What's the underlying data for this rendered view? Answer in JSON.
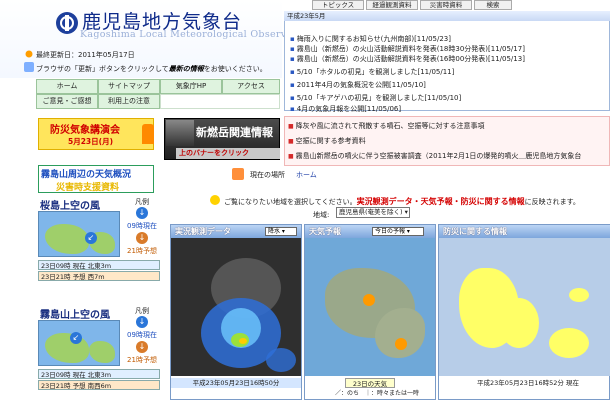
{
  "header": {
    "title": "鹿児島地方気象台",
    "title_en": "Kagoshima Local Meteorological Observatory",
    "updated": "最終更新日：2011年05月17日",
    "browser_note_pre": "ブラウザの「更新」ボタンをクリックして",
    "browser_note_bold": "最新の情報",
    "browser_note_post": "をお使いください。"
  },
  "nav": {
    "row1": [
      "ホーム",
      "サイトマップ",
      "気象庁HP",
      "アクセス"
    ],
    "row2": [
      "ご意見・ご感想",
      "利用上の注意"
    ]
  },
  "top_tabs": [
    "トピックス",
    "経過観測資料",
    "災害時資料",
    "検索"
  ],
  "topics": {
    "head": "平成23年5月",
    "items": [
      "梅雨入りに関するお知らせ(九州南部)[11/05/23]",
      "霧島山（新燃岳）の火山活動解説資料を発表(18時30分発表)[11/05/17]",
      "霧島山（新燃岳）の火山活動解説資料を発表(16時00分発表)[11/05/13]",
      "5/10「ホタルの初見」を観測しました[11/05/11]",
      "2011年4月の気象概況を公開[11/05/10]",
      "5/10「キアゲハの初見」を観測しました[11/05/10]",
      "4月の気象月報を公開[11/05/06]"
    ]
  },
  "alerts": [
    "降灰や風に流されて飛散する噴石、空振等に対する注意事項",
    "空振に関する参考資料",
    "霧島山新燃岳の噴火に伴う空振被害調査（2011年2月1日の爆発的噴火＿鹿児島地方気象台"
  ],
  "banners": {
    "bousai_title": "防災気象講演会",
    "bousai_date": "5月23日(月)",
    "shinmoe_title": "新燃岳関連情報",
    "shinmoe_sub": "上のバナーをクリック",
    "kirishima_line1": "霧島山周辺の天気概況",
    "kirishima_line2": "災害時支援資料"
  },
  "location": {
    "label": "現在の場所",
    "home": "ホーム"
  },
  "wind": [
    {
      "title": "桜島上空の風",
      "legend": "凡例",
      "t1": "09時現在",
      "t2": "21時予想",
      "status1": "23日09時 現在 北東3m",
      "status2": "23日21時 予想 西7m"
    },
    {
      "title": "霧島山上空の風",
      "legend": "凡例",
      "t1": "09時現在",
      "t2": "21時予想",
      "status1": "23日09時 現在 北東3m",
      "status2": "23日21時 予想 南西6m"
    }
  ],
  "notice": {
    "pre": "ご覧になりたい地域を選択してください。",
    "bold": "実況観測データ・天気予報・防災に関する情報",
    "post": "に反映されます。",
    "region_label": "地域:",
    "region_value": "鹿児島県(奄美を除く)"
  },
  "panels": {
    "radar": {
      "title": "実況観測データ",
      "select": "降水",
      "footer": "平成23年05月23日16時50分"
    },
    "forecast": {
      "title": "天気予報",
      "select": "今日の予報",
      "footer": "23日の天気",
      "legend_footer": "／：のち　｜：時々または一時"
    },
    "warnings": {
      "title": "防災に関する情報",
      "footer": "平成23年05月23日16時52分 現在"
    }
  },
  "colors": {
    "brand": "#0e2a8a",
    "alert": "#d42a2a",
    "panel_head": "#7ea6dc"
  }
}
